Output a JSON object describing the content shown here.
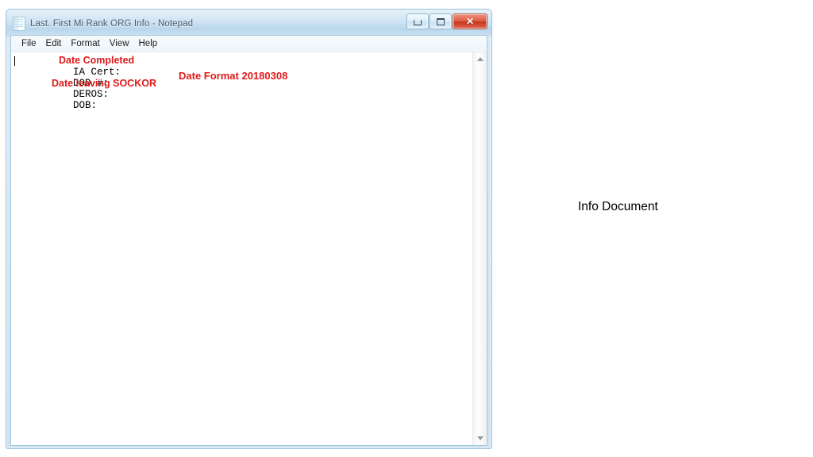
{
  "window": {
    "title": "Last. First Mi Rank ORG Info - Notepad",
    "icon": "notepad-icon",
    "controls": {
      "minimize": "minimize-icon",
      "maximize": "maximize-icon",
      "close": "✕"
    }
  },
  "menu": {
    "items": [
      {
        "label": "File"
      },
      {
        "label": "Edit"
      },
      {
        "label": "Format"
      },
      {
        "label": "View"
      },
      {
        "label": "Help"
      }
    ]
  },
  "document": {
    "lines": [
      {
        "text": "IA Cert:"
      },
      {
        "text": "DOD #:"
      },
      {
        "text": "DEROS:"
      },
      {
        "text": "DOB:"
      }
    ],
    "annotations": {
      "date_completed": "Date Completed",
      "date_leaving": "Date leaving SOCKOR",
      "date_format": "Date Format 20180308"
    },
    "annotation_color": "#E01A1A"
  },
  "scrollbar": {
    "up_arrow": "scroll-up-icon",
    "down_arrow": "scroll-down-icon"
  },
  "caption": {
    "text": "Info Document"
  }
}
